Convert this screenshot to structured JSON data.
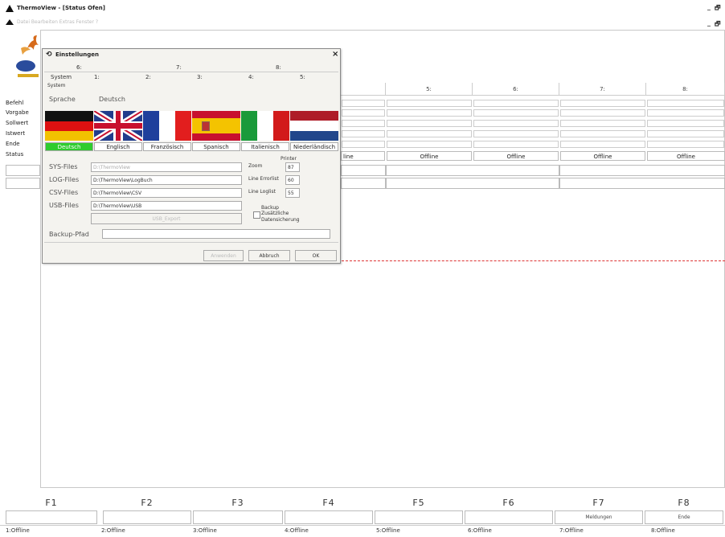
{
  "window": {
    "title": "ThermoView - [Status Ofen]",
    "menu": "Datei  Bearbeiten  Extras  Fenster  ?",
    "min": "_",
    "max": "🗗"
  },
  "left_labels": [
    "Befehl",
    "Vorgabe",
    "Sollwert",
    "Istwert",
    "Ende",
    "Status"
  ],
  "columns": [
    {
      "label": "5:"
    },
    {
      "label": "6:"
    },
    {
      "label": "7:"
    },
    {
      "label": "8:"
    }
  ],
  "partial_offline": "line",
  "offline_text": "Offline",
  "dialog": {
    "title": "Einstellungen",
    "close": "×",
    "tabs_top": [
      "6:",
      "7:",
      "8:"
    ],
    "tabs_bottom": [
      "System",
      "1:",
      "2:",
      "3:",
      "4:",
      "5:"
    ],
    "group_label": "System",
    "sprache_label": "Sprache",
    "sprache_value": "Deutsch",
    "flags": [
      "Deutsch",
      "Englisch",
      "Französisch",
      "Spanisch",
      "Italienisch",
      "Niederländisch"
    ],
    "selected_flag_color": "#2ecc2e",
    "paths": [
      {
        "label": "SYS-Files",
        "value": "D:\\ThermoView"
      },
      {
        "label": "LOG-Files",
        "value": "D:\\ThermoView\\LogBuch"
      },
      {
        "label": "CSV-Files",
        "value": "D:\\ThermoView\\CSV"
      },
      {
        "label": "USB-Files",
        "value": "D:\\ThermoView\\USB"
      }
    ],
    "usb_button": "USB_Export",
    "printer_label": "Printer",
    "zoom_label": "Zoom",
    "zoom_value": "87",
    "line_error_label": "Line Errorlist",
    "line_error_value": "60",
    "line_log_label": "Line Loglist",
    "line_log_value": "55",
    "backup_title": "Backup",
    "backup_check": "Zusätzliche Datensicherung",
    "backup_path_label": "Backup-Pfad",
    "btn_apply": "Anwenden",
    "btn_cancel": "Abbruch",
    "btn_ok": "OK"
  },
  "fkeys": [
    {
      "name": "F1",
      "label": ""
    },
    {
      "name": "F2",
      "label": ""
    },
    {
      "name": "F3",
      "label": ""
    },
    {
      "name": "F4",
      "label": ""
    },
    {
      "name": "F5",
      "label": ""
    },
    {
      "name": "F6",
      "label": ""
    },
    {
      "name": "F7",
      "label": "Meldungen"
    },
    {
      "name": "F8",
      "label": "Ende"
    }
  ],
  "status": [
    "1:Offline",
    "2:Offline",
    "3:Offline",
    "4:Offline",
    "5:Offline",
    "6:Offline",
    "7:Offline",
    "8:Offline"
  ]
}
